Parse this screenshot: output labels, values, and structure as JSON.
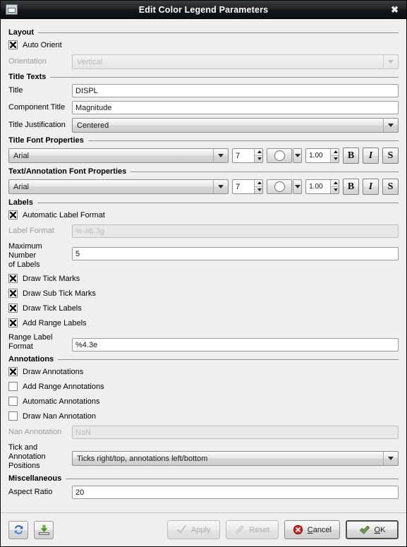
{
  "window": {
    "title": "Edit Color Legend Parameters",
    "icon": "window-icon",
    "close_label": "✖"
  },
  "sections": {
    "layout": {
      "title": "Layout",
      "auto_orient": {
        "label": "Auto Orient",
        "checked": true
      },
      "orientation": {
        "label": "Orientation",
        "value": "Vertical",
        "enabled": false
      }
    },
    "title_texts": {
      "title": "Title Texts",
      "title_field": {
        "label": "Title",
        "value": "DISPL"
      },
      "component_title": {
        "label": "Component Title",
        "value": "Magnitude"
      },
      "title_justification": {
        "label": "Title Justification",
        "value": "Centered"
      }
    },
    "title_font": {
      "title": "Title Font Properties",
      "family": "Arial",
      "size": "7",
      "color": "#ffffff",
      "opacity": "1.00",
      "bold_label": "B",
      "italic_label": "I",
      "shadow_label": "S"
    },
    "text_font": {
      "title": "Text/Annotation Font Properties",
      "family": "Arial",
      "size": "7",
      "color": "#ffffff",
      "opacity": "1.00",
      "bold_label": "B",
      "italic_label": "I",
      "shadow_label": "S"
    },
    "labels": {
      "title": "Labels",
      "automatic_label_format": {
        "label": "Automatic Label Format",
        "checked": true
      },
      "label_format": {
        "label": "Label Format",
        "value": "",
        "placeholder": "%-#6.3g",
        "enabled": false
      },
      "maximum_number_of_labels": {
        "label": "Maximum Number\nof Labels",
        "value": "5"
      },
      "draw_tick_marks": {
        "label": "Draw Tick Marks",
        "checked": true
      },
      "draw_sub_tick_marks": {
        "label": "Draw Sub Tick Marks",
        "checked": true
      },
      "draw_tick_labels": {
        "label": "Draw Tick Labels",
        "checked": true
      },
      "add_range_labels": {
        "label": "Add Range Labels",
        "checked": true
      },
      "range_label_format": {
        "label": "Range Label\nFormat",
        "value": "%4.3e"
      }
    },
    "annotations": {
      "title": "Annotations",
      "draw_annotations": {
        "label": "Draw Annotations",
        "checked": true
      },
      "add_range_annotations": {
        "label": "Add Range Annotations",
        "checked": false
      },
      "automatic_annotations": {
        "label": "Automatic Annotations",
        "checked": false
      },
      "draw_nan_annotation": {
        "label": "Draw Nan Annotation",
        "checked": false
      },
      "nan_annotation": {
        "label": "Nan Annotation",
        "value": "",
        "placeholder": "NaN",
        "enabled": false
      },
      "tick_and_annotation_positions": {
        "label": "Tick and\nAnnotation\nPositions",
        "value": "Ticks right/top, annotations left/bottom"
      }
    },
    "miscellaneous": {
      "title": "Miscellaneous",
      "aspect_ratio": {
        "label": "Aspect Ratio",
        "value": "20"
      }
    }
  },
  "buttonbar": {
    "reload": {
      "name": "reload-icon",
      "color": "#2a62b0"
    },
    "save": {
      "name": "save-to-disk-icon",
      "color": "#4f9a1e"
    },
    "apply": {
      "label": "Apply",
      "enabled": false,
      "icon": "checkmark-icon"
    },
    "reset": {
      "label": "Reset",
      "enabled": false,
      "icon": "brush-icon"
    },
    "cancel": {
      "mnemonic": "C",
      "rest": "ancel",
      "icon": "error-circle-icon",
      "color": "#cc1f1f"
    },
    "ok": {
      "mnemonic": "O",
      "rest": "K",
      "icon": "green-check-icon",
      "color": "#5f8c3a"
    }
  }
}
